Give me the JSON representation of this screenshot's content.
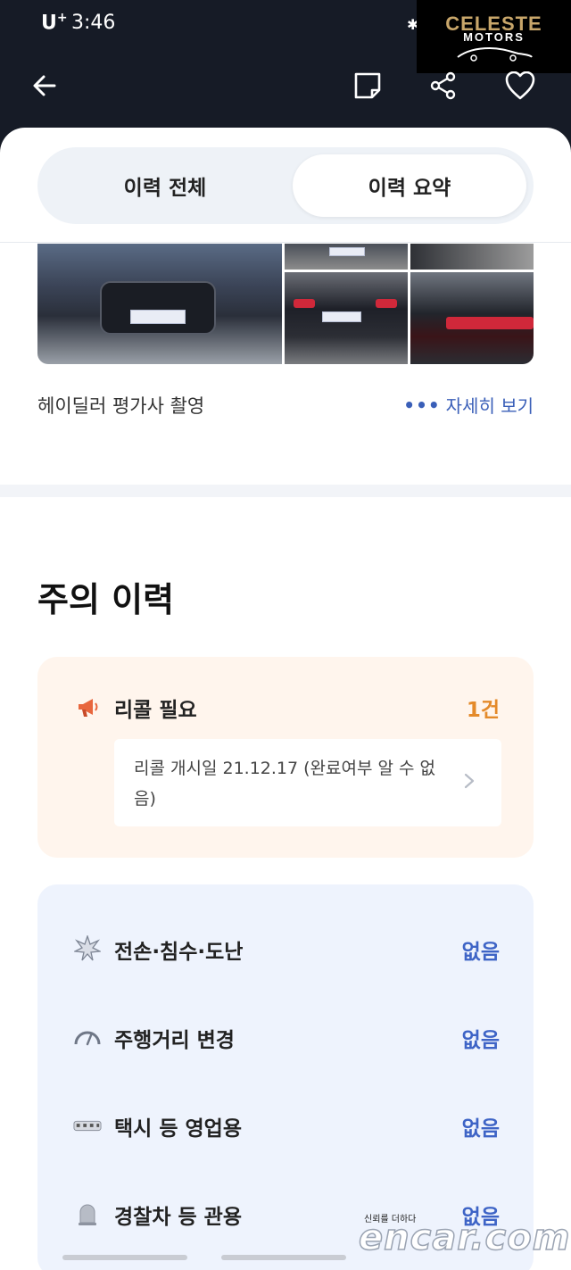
{
  "status_bar": {
    "carrier": "U",
    "carrier_sup": "+",
    "time": "3:46"
  },
  "logo": {
    "line1": "CELESTE",
    "line2": "MOTORS"
  },
  "nav": {
    "back_icon": "arrow-left-icon",
    "memo_icon": "note-icon",
    "share_icon": "share-icon",
    "favorite_icon": "heart-icon"
  },
  "tabs": [
    {
      "label": "이력 전체",
      "selected": false
    },
    {
      "label": "이력 요약",
      "selected": true
    }
  ],
  "photos": {
    "caption": "헤이딜러 평가사 촬영",
    "more_label": "자세히 보기"
  },
  "caution": {
    "title": "주의 이력",
    "recall": {
      "label": "리콜 필요",
      "count": "1건",
      "detail": "리콜 개시일 21.12.17 (완료여부 알 수 없음)"
    },
    "items": [
      {
        "label": "전손·침수·도난",
        "value": "없음",
        "icon": "burst-icon"
      },
      {
        "label": "주행거리 변경",
        "value": "없음",
        "icon": "speedometer-icon"
      },
      {
        "label": "택시 등 영업용",
        "value": "없음",
        "icon": "taxi-sign-icon"
      },
      {
        "label": "경찰차 등 관용",
        "value": "없음",
        "icon": "siren-icon"
      }
    ]
  },
  "colors": {
    "accent_blue": "#3e64c6",
    "recall_orange": "#e48a2a",
    "header_bg": "#161b26"
  },
  "watermark": {
    "tagline": "신뢰를 더하다",
    "brand": "encar.com"
  }
}
